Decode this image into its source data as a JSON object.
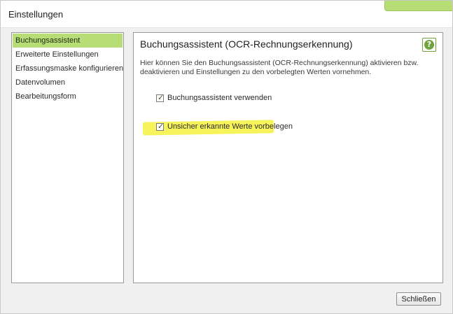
{
  "dialog": {
    "title": "Einstellungen"
  },
  "sidebar": {
    "items": [
      {
        "label": "Buchungsassistent",
        "active": true
      },
      {
        "label": "Erweiterte Einstellungen"
      },
      {
        "label": "Erfassungsmaske konfigurieren"
      },
      {
        "label": "Datenvolumen"
      },
      {
        "label": "Bearbeitungsform"
      }
    ]
  },
  "content": {
    "heading": "Buchungsassistent (OCR-Rechnungserkennung)",
    "help_icon": "question-circle-icon",
    "help_symbol": "?",
    "description": "Hier können Sie den Buchungsassistent (OCR-Rechnungserkennung) aktivieren bzw. deaktivieren und Einstellungen zu den vorbelegten Werten vornehmen.",
    "options": [
      {
        "label": "Buchungsassistent verwenden",
        "checked": true,
        "check_glyph": "✓"
      },
      {
        "label": "Unsicher erkannte Werte vorbelegen",
        "checked": true,
        "check_glyph": "✓",
        "highlighted": true
      }
    ]
  },
  "footer": {
    "close_label": "Schließen"
  },
  "colors": {
    "accent": "#b7dd77",
    "help_green": "#6fa33b",
    "highlight": "#f7f35a"
  }
}
